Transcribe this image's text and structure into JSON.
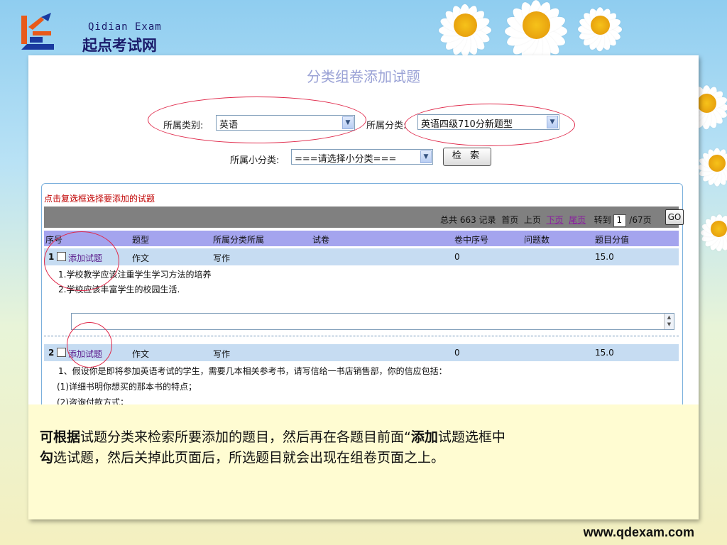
{
  "brand": {
    "name_en": "Qidian Exam",
    "name_cn": "起点考试网"
  },
  "form": {
    "title": "分类组卷添加试题",
    "category_label": "所属类别:",
    "category_value": "英语",
    "classify_label": "所属分类:",
    "classify_value": "英语四级710分新题型",
    "subclass_label": "所属小分类:",
    "subclass_value": "===请选择小分类===",
    "search_button": "检 索"
  },
  "list": {
    "hint": "点击复选框选择要添加的试题",
    "pager": {
      "total": "总共 663 记录",
      "first": "首页",
      "prev": "上页",
      "next": "下页",
      "last": "尾页",
      "goto_label": "转到",
      "page_value": "1",
      "page_total": "/67页",
      "go_button": "GO"
    },
    "columns": [
      "序号",
      "题型",
      "所属分类所属",
      "试卷",
      "卷中序号",
      "问题数",
      "题目分值"
    ],
    "rows": [
      {
        "num": "1",
        "add": "添加试题",
        "type": "作文",
        "category": "写作",
        "paper": "",
        "index": "0",
        "questions": "",
        "score": "15.0",
        "lines": [
          "1.学校教学应该注重学生学习方法的培养",
          "2.学校应该丰富学生的校园生活."
        ]
      },
      {
        "num": "2",
        "add": "添加试题",
        "type": "作文",
        "category": "写作",
        "paper": "",
        "index": "0",
        "questions": "",
        "score": "15.0",
        "lines": [
          "1、假设你是即将参加英语考试的学生，需要几本相关参考书，请写信给一书店销售部，你的信应包括：",
          "(1)详细书明你想买的那本书的特点；",
          "(2)咨询付款方式；"
        ]
      }
    ]
  },
  "caption": {
    "p1_bold": "可根据",
    "p1": "试题分类来检索所要添加的题目，然后再在各题目前面“",
    "p2_bold": "添加",
    "p2": "试题选框中",
    "p3_bold": "勾",
    "p3": "选试题，然后关掉此页面后，所选题目就会出现在组卷页面之上。"
  },
  "footer": {
    "url": "www.qdexam.com"
  },
  "colors": {
    "accent_red": "#e02a4b",
    "header_purple": "#a4a4ee",
    "row_blue": "#c6dcf2"
  }
}
